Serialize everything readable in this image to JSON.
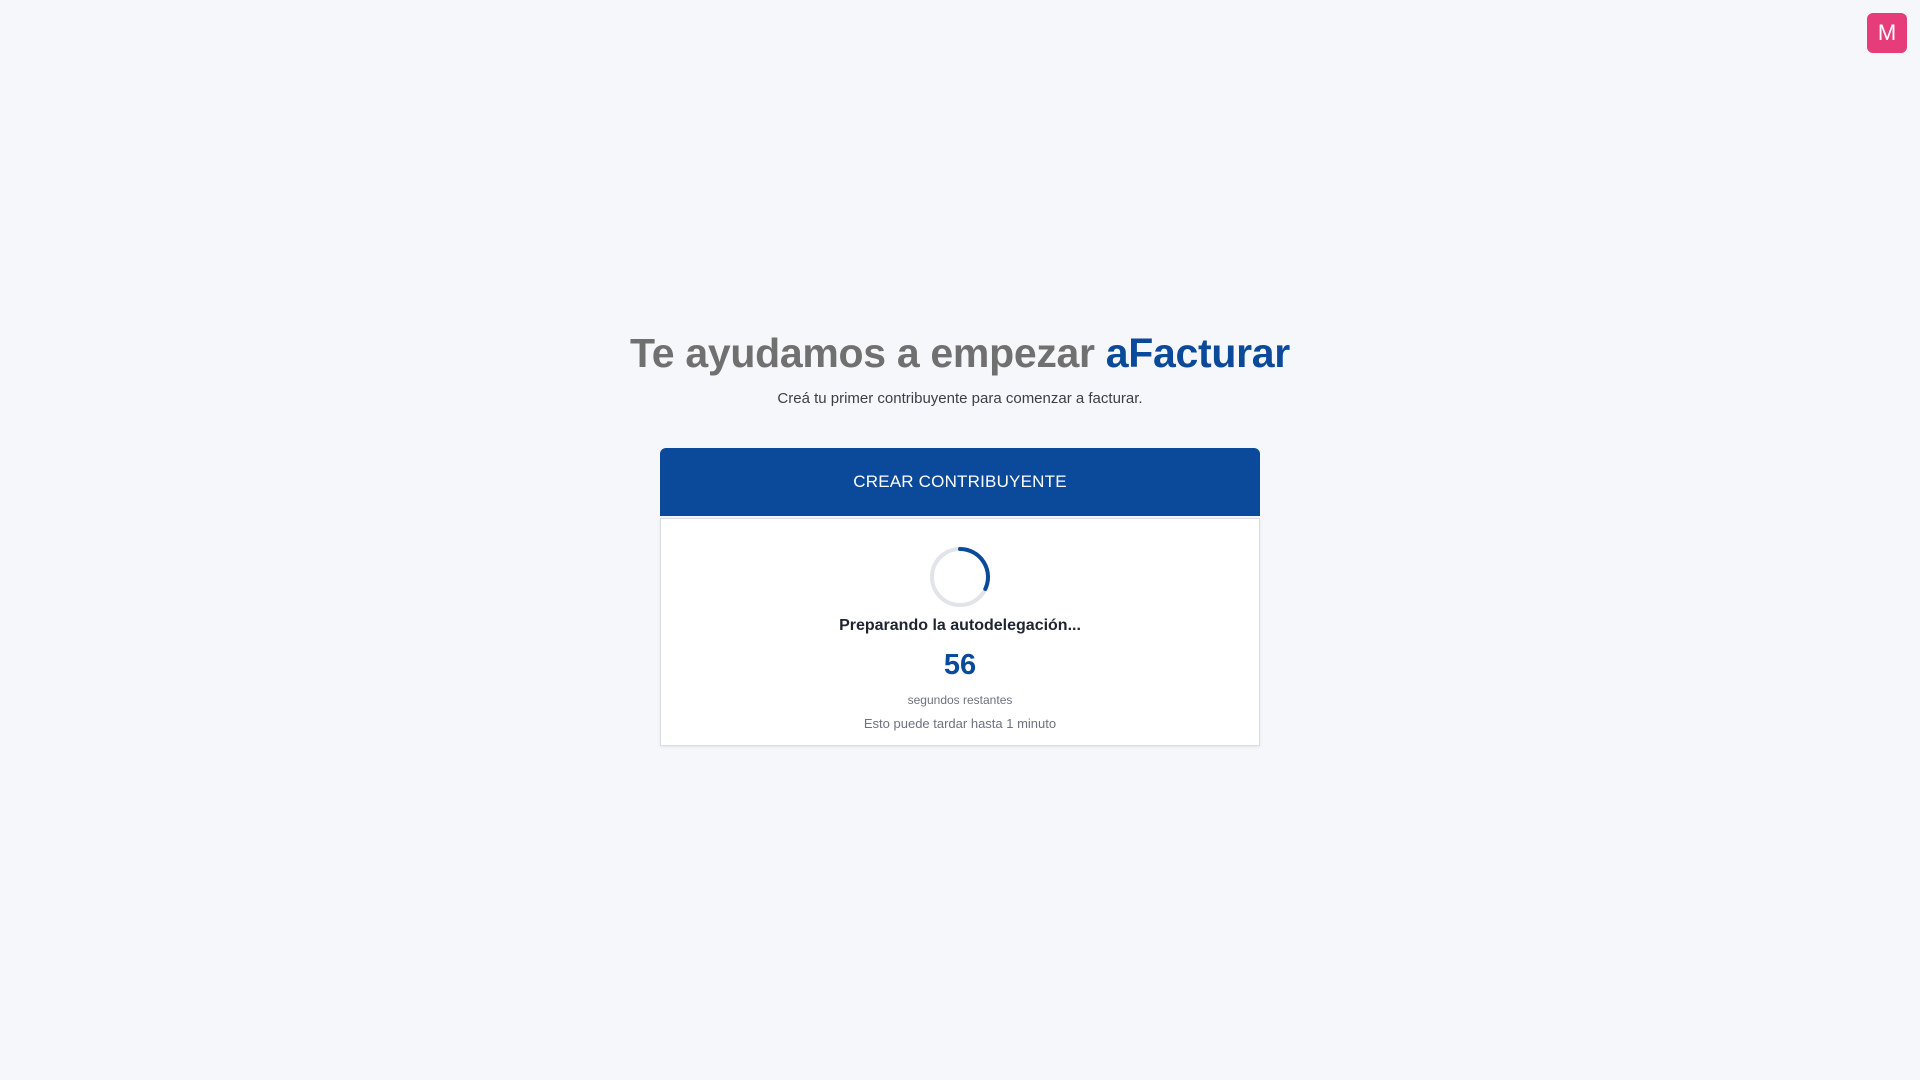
{
  "user": {
    "avatar_initial": "M",
    "avatar_color": "#e63d7a"
  },
  "hero": {
    "title_prefix": "Te ayudamos a empezar",
    "brand": "aFacturar",
    "subtitle": "Creá tu primer contribuyente para comenzar a facturar."
  },
  "card": {
    "header": "CREAR CONTRIBUYENTE",
    "status": "Preparando la autodelegación...",
    "countdown": "56",
    "countdown_label": "segundos restantes",
    "note": "Esto puede tardar hasta 1 minuto"
  },
  "colors": {
    "primary": "#0b4a9b",
    "background": "#f5f7fa",
    "spinner_track": "#e1e4e8"
  },
  "icons": {
    "spinner": "loading-spinner-icon"
  }
}
